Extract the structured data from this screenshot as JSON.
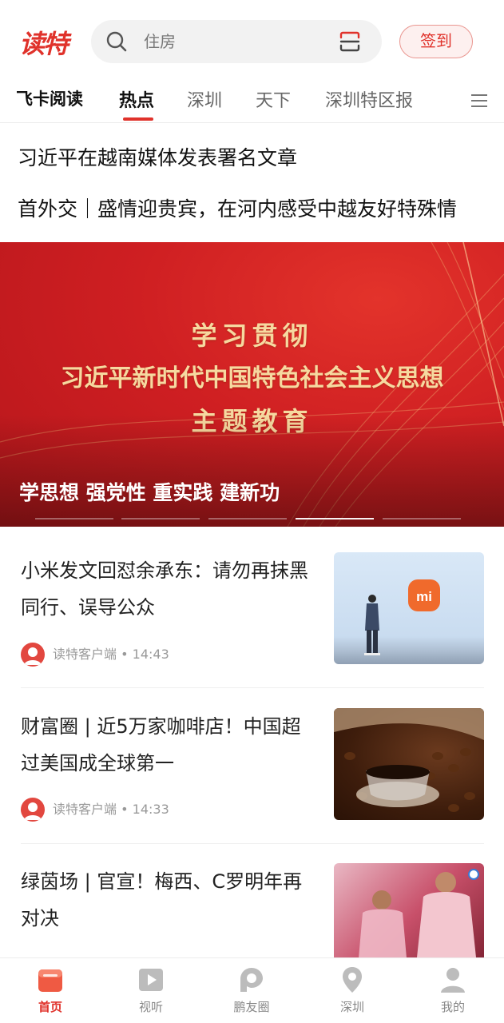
{
  "app": {
    "logo_text": "读特",
    "brand_color": "#e0322b"
  },
  "header": {
    "search_value": "住房",
    "signin_label": "签到"
  },
  "tabs": [
    {
      "label": "飞卡阅读"
    },
    {
      "label": "热点",
      "active": true
    },
    {
      "label": "深圳"
    },
    {
      "label": "天下"
    },
    {
      "label": "深圳特区报"
    }
  ],
  "headlines": [
    "习近平在越南媒体发表署名文章",
    "首外交｜盛情迎贵宾，在河内感受中越友好特殊情"
  ],
  "banner": {
    "lines": [
      "学习贯彻",
      "习近平新时代中国特色社会主义思想",
      "主题教育"
    ],
    "caption": "学思想 强党性 重实践 建新功",
    "slide_count": 5,
    "active_slide": 4
  },
  "news": [
    {
      "title": "小米发文回怼余承东：请勿再抹黑同行、误导公众",
      "source": "读特客户端",
      "time": "14:43",
      "thumb_icon": "xiaomi-stage-photo",
      "thumb_logo": "mi"
    },
    {
      "title": "财富圈 | 近5万家咖啡店！中国超过美国成全球第一",
      "source": "读特客户端",
      "time": "14:33",
      "thumb_icon": "coffee-beans-photo"
    },
    {
      "title": "绿茵场 | 官宣！梅西、C罗明年再对决",
      "thumb_icon": "football-players-photo"
    }
  ],
  "meta_separator": "•",
  "bottom_nav": [
    {
      "label": "首页",
      "icon": "home-icon",
      "active": true
    },
    {
      "label": "视听",
      "icon": "play-icon"
    },
    {
      "label": "鹏友圈",
      "icon": "pengyou-icon"
    },
    {
      "label": "深圳",
      "icon": "location-icon"
    },
    {
      "label": "我的",
      "icon": "profile-icon"
    }
  ]
}
